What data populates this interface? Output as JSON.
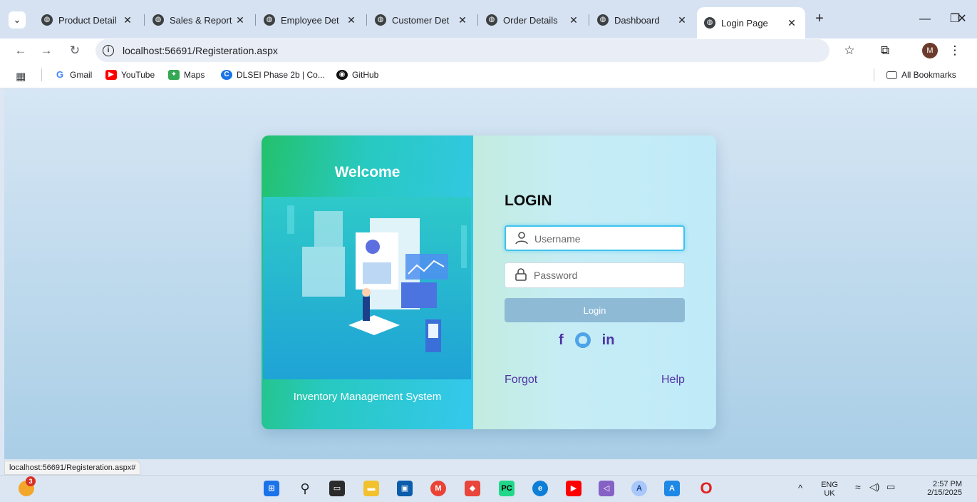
{
  "browser": {
    "tabs": [
      {
        "title": "Product Detail"
      },
      {
        "title": "Sales & Report"
      },
      {
        "title": "Employee Det"
      },
      {
        "title": "Customer Det"
      },
      {
        "title": "Order Details"
      },
      {
        "title": "Dashboard"
      },
      {
        "title": "Login Page",
        "active": true
      }
    ],
    "url": "localhost:56691/Registeration.aspx",
    "profile_initial": "M",
    "bookmarks": [
      {
        "label": "Gmail",
        "icon": "gmail-icon"
      },
      {
        "label": "YouTube",
        "icon": "youtube-icon"
      },
      {
        "label": "Maps",
        "icon": "maps-icon"
      },
      {
        "label": "DLSEI Phase 2b | Co...",
        "icon": "dlsei-icon"
      },
      {
        "label": "GitHub",
        "icon": "github-icon"
      }
    ],
    "all_bookmarks_label": "All Bookmarks",
    "status_url": "localhost:56691/Registeration.aspx#"
  },
  "login_card": {
    "welcome": "Welcome",
    "subtitle": "Inventory Management System",
    "title": "LOGIN",
    "username_placeholder": "Username",
    "password_placeholder": "Password",
    "login_button": "Login",
    "socials": [
      "f",
      "in"
    ],
    "forgot_label": "Forgot",
    "help_label": "Help"
  },
  "taskbar": {
    "notification_count": "3",
    "language": "ENG",
    "region": "UK",
    "time": "2:57 PM",
    "date": "2/15/2025"
  },
  "colors": {
    "card_left_accent": "#23c16b",
    "card_right_bg": "#c6edf6",
    "link_color": "#4f32a5",
    "login_button": "#8ebad6"
  }
}
